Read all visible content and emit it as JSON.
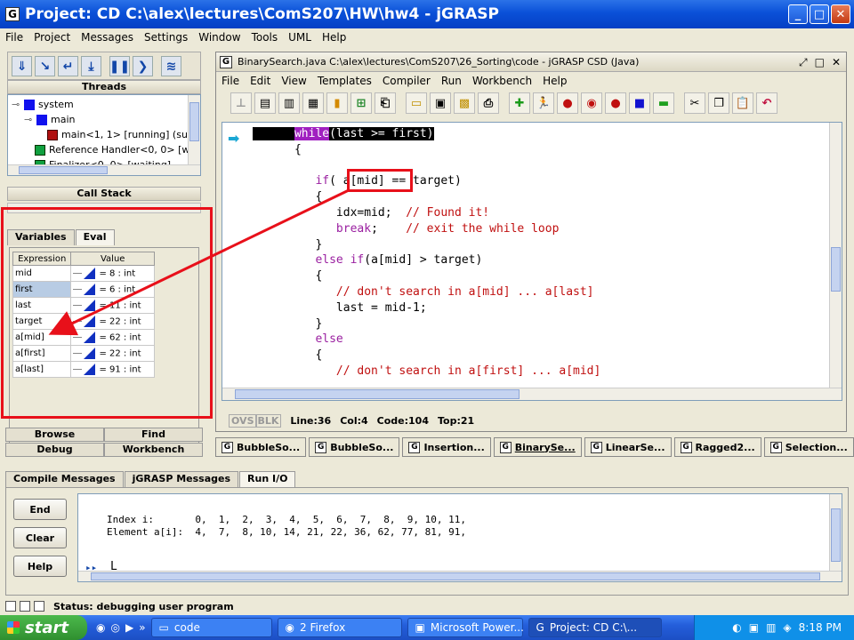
{
  "window": {
    "title": "Project: CD  C:\\alex\\lectures\\ComS207\\HW\\hw4  - jGRASP"
  },
  "menubar": [
    "File",
    "Project",
    "Messages",
    "Settings",
    "Window",
    "Tools",
    "UML",
    "Help"
  ],
  "left": {
    "threads_title": "Threads",
    "tree": [
      {
        "label": "system",
        "icon": "blue"
      },
      {
        "label": "main",
        "icon": "blue"
      },
      {
        "label": "main<1, 1> [running] (su",
        "icon": "red"
      },
      {
        "label": "Reference Handler<0, 0> [w",
        "icon": "green"
      },
      {
        "label": "Finalizer<0, 0> [waiting]",
        "icon": "green"
      }
    ],
    "callstack_title": "Call Stack",
    "tabs": [
      "Variables",
      "Eval"
    ],
    "eval_headers": [
      "Expression",
      "Value"
    ],
    "eval_rows": [
      {
        "expr": "mid",
        "value": "= 8 : int"
      },
      {
        "expr": "first",
        "value": "= 6 : int"
      },
      {
        "expr": "last",
        "value": "= 11 : int"
      },
      {
        "expr": "target",
        "value": "= 22 : int"
      },
      {
        "expr": "a[mid]",
        "value": "= 62 : int"
      },
      {
        "expr": "a[first]",
        "value": "= 22 : int"
      },
      {
        "expr": "a[last]",
        "value": "= 91 : int"
      }
    ],
    "bottom_tabs_row1": [
      "Browse",
      "Find"
    ],
    "bottom_tabs_row2": [
      "Debug",
      "Workbench"
    ]
  },
  "csd": {
    "title": "BinarySearch.java  C:\\alex\\lectures\\ComS207\\26_Sorting\\code - jGRASP CSD (Java)",
    "menu": [
      "File",
      "Edit",
      "View",
      "Templates",
      "Compiler",
      "Run",
      "Workbench",
      "Help"
    ],
    "code": {
      "l1_kw": "while",
      "l1_rest": "(last >= first)",
      "l2": "{",
      "l4_kw": "if",
      "l4_rest": "( a[mid] == target)",
      "l5": "{",
      "l6_a": "idx=mid;  ",
      "l6_c": "// Found it!",
      "l7_kw": "break",
      "l7_a": ";    ",
      "l7_c": "// exit the while loop",
      "l8": "}",
      "l9_kw": "else if",
      "l9_rest": "(a[mid] > target)",
      "l10": "{",
      "l11_c": "// don't search in a[mid] ... a[last]",
      "l12": "last = mid-1;",
      "l13": "}",
      "l14_kw": "else",
      "l15": "{",
      "l16_c": "// don't search in a[first] ... a[mid]"
    },
    "status": {
      "ovs": "OVS",
      "blk": "BLK",
      "line": "Line:36",
      "col": "Col:4",
      "code": "Code:104",
      "top": "Top:21"
    }
  },
  "file_tabs": [
    "BubbleSo...",
    "BubbleSo...",
    "Insertion...",
    "BinarySe...",
    "LinearSe...",
    "Ragged2...",
    "Selection..."
  ],
  "messages": {
    "tabs": [
      "Compile Messages",
      "jGRASP Messages",
      "Run I/O"
    ],
    "buttons": [
      "End",
      "Clear",
      "Help"
    ],
    "io_line1": "Index i:       0,  1,  2,  3,  4,  5,  6,  7,  8,  9, 10, 11,",
    "io_line2": "Element a[i]:  4,  7,  8, 10, 14, 21, 22, 36, 62, 77, 81, 91,",
    "prompt": "▸▸",
    "cursor": "L"
  },
  "status": {
    "text": "Status: debugging user program"
  },
  "taskbar": {
    "start": "start",
    "tasks": [
      "code",
      "2 Firefox",
      "Microsoft Power...",
      "Project: CD  C:\\..."
    ],
    "time": "8:18 PM"
  },
  "colors": {
    "highlight_red": "#e8101a",
    "keyword": "#9a1fa0",
    "comment": "#c01010"
  }
}
